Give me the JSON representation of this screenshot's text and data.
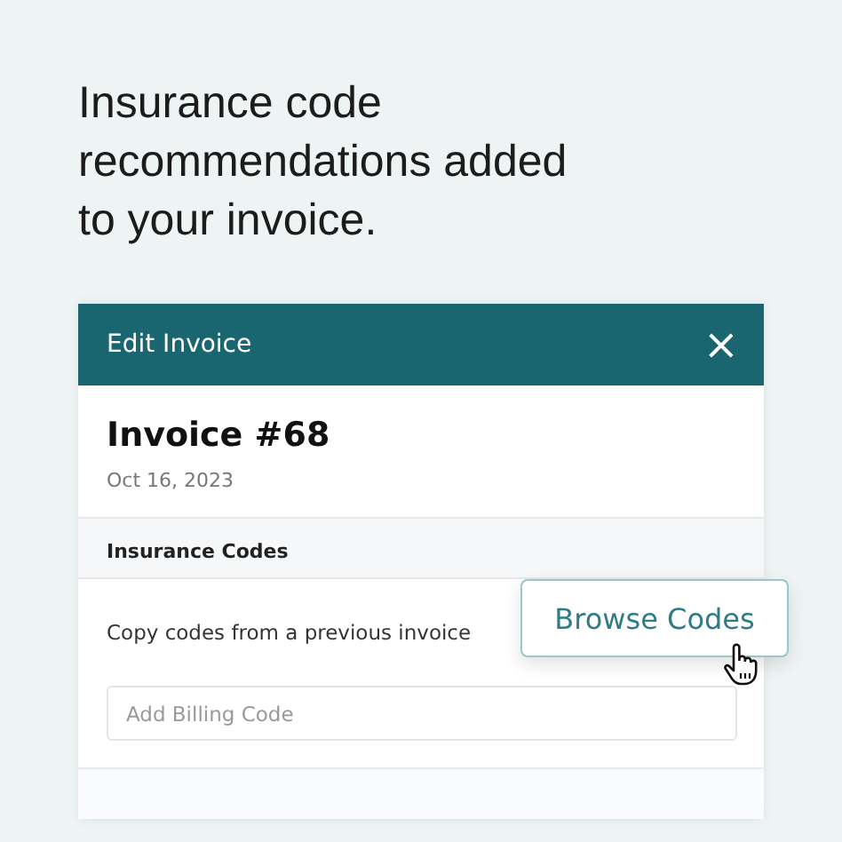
{
  "headline": "Insurance code recommendations added to your invoice.",
  "window": {
    "title": "Edit Invoice",
    "close": "×"
  },
  "invoice": {
    "title": "Invoice #68",
    "date": "Oct 16, 2023"
  },
  "section": {
    "title": "Insurance Codes",
    "copy_text": "Copy codes from a previous invoice",
    "button": "Browse Codes",
    "field": {
      "placeholder": "Add Billing Code"
    }
  }
}
